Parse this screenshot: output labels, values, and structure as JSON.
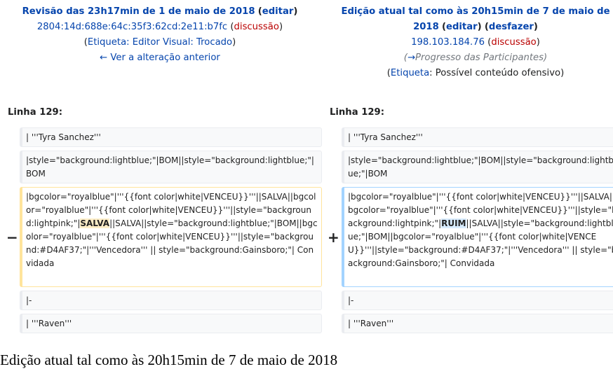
{
  "left_header": {
    "title": "Revisão das 23h17min de 1 de maio de 2018",
    "edit_label": "editar",
    "user": "2804:14d:688e:64c:35f3:62cd:2e11:b7fc",
    "talk_label": "discussão",
    "tag_label": "Etiqueta",
    "tag_value": ": Editor Visual: Trocado",
    "prev_link": "← Ver a alteração anterior"
  },
  "right_header": {
    "title_line1": "Edição atual tal como às 20h15min de 7 de maio de",
    "title_line2": "2018",
    "edit_label": "editar",
    "undo_label": "desfazer",
    "user": "198.103.184.76",
    "talk_label": "discussão",
    "section_arrow": "→",
    "section_text": "Progresso das Participantes",
    "tag_label": "Etiqueta",
    "tag_value": ": Possível conteúdo ofensivo"
  },
  "diff": {
    "line_label_left": "Linha 129:",
    "line_label_right": "Linha 129:",
    "minus": "−",
    "plus": "+",
    "context1": "| '''Tyra Sanchez'''",
    "context2": "|style=\"background:lightblue;\"|BOM||style=\"background:lightblue;\"|BOM",
    "del_before": "|bgcolor=\"royalblue\"|'''{{font color|white|VENCEU}}'''||SALVA||bgcolor=\"royalblue\"|'''{{font color|white|VENCEU}}'''||style=\"background:lightpink;\"|",
    "del_changed": "SALVA",
    "del_after": "||SALVA||style=\"background:lightblue;\"|BOM||bgcolor=\"royalblue\"|'''{{font color|white|VENCEU}}'''||style=\"background:#D4AF37;\"|'''Vencedora''' || style=\"background:Gainsboro;\"| Convidada",
    "add_before": "|bgcolor=\"royalblue\"|'''{{font color|white|VENCEU}}'''||SALVA||bgcolor=\"royalblue\"|'''{{font color|white|VENCEU}}'''||style=\"background:lightpink;\"|",
    "add_changed": "RUIM",
    "add_after": "||SALVA||style=\"background:lightblue;\"|BOM||bgcolor=\"royalblue\"|'''{{font color|white|VENCEU}}'''||style=\"background:#D4AF37;\"|'''Vencedora''' || style=\"background:Gainsboro;\"| Convidada",
    "context3": "|-",
    "context4": "| '''Raven'''"
  },
  "footer": "Edição atual tal como às 20h15min de 7 de maio de 2018"
}
